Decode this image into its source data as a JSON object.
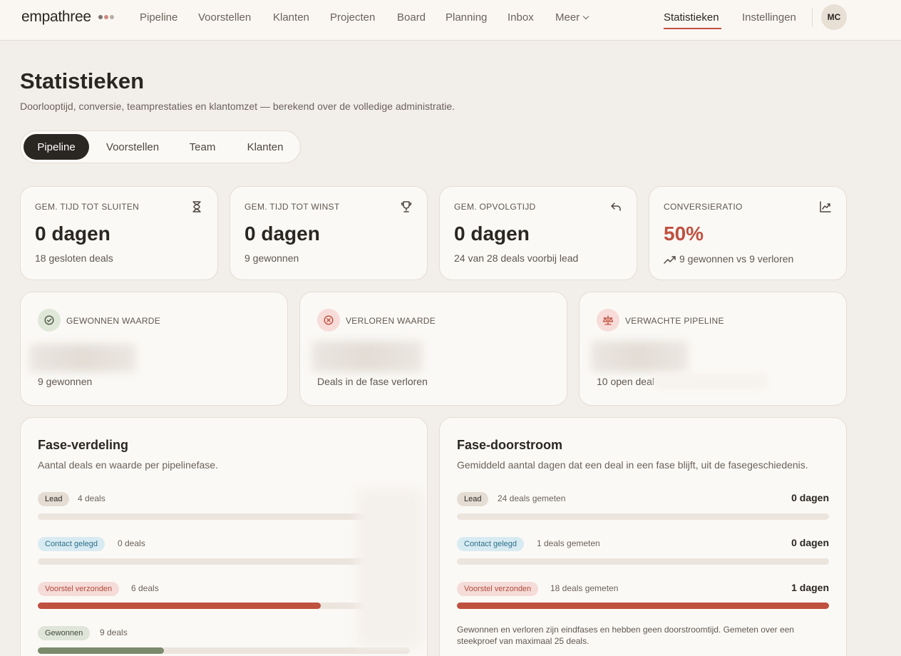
{
  "brand": {
    "name": "empathree",
    "dots": [
      "#7c7470",
      "#d08a80",
      "#b8b0a8"
    ]
  },
  "nav": {
    "items": [
      {
        "label": "Pipeline"
      },
      {
        "label": "Voorstellen"
      },
      {
        "label": "Klanten"
      },
      {
        "label": "Projecten"
      },
      {
        "label": "Board"
      },
      {
        "label": "Planning"
      },
      {
        "label": "Inbox"
      },
      {
        "label": "Meer"
      }
    ],
    "active": "Statistieken",
    "settings": "Instellingen",
    "avatar": "MC"
  },
  "page": {
    "title": "Statistieken",
    "subtitle": "Doorlooptijd, conversie, teamprestaties en klantomzet — berekend over de volledige administratie."
  },
  "tabs": [
    "Pipeline",
    "Voorstellen",
    "Team",
    "Klanten"
  ],
  "kpis": [
    {
      "label": "GEM. TIJD TOT SLUITEN",
      "value": "0 dagen",
      "foot": "18 gesloten deals",
      "icon": "hourglass-icon"
    },
    {
      "label": "GEM. TIJD TOT WINST",
      "value": "0 dagen",
      "foot": "9 gewonnen",
      "icon": "trophy-icon"
    },
    {
      "label": "GEM. OPVOLGTIJD",
      "value": "0 dagen",
      "foot": "24 van 28 deals voorbij lead",
      "icon": "reply-icon"
    },
    {
      "label": "CONVERSIERATIO",
      "value": "50%",
      "foot": "9 gewonnen vs 9 verloren",
      "icon": "chart-icon"
    }
  ],
  "values": [
    {
      "label": "GEWONNEN WAARDE",
      "foot": "9 gewonnen",
      "icon": "check-circle-icon",
      "badge_bg": "#dfe7d9",
      "icon_color": "#4a5940"
    },
    {
      "label": "VERLOREN WAARDE",
      "foot": "Deals in de fase verloren",
      "icon": "x-circle-icon",
      "badge_bg": "#f7dcd9",
      "icon_color": "#c0503f"
    },
    {
      "label": "VERWACHTE PIPELINE",
      "foot": "10 open deal",
      "icon": "scale-icon",
      "badge_bg": "#f7dcd9",
      "icon_color": "#c0503f"
    }
  ],
  "fase_verdeling": {
    "title": "Fase-verdeling",
    "subtitle": "Aantal deals en waarde per pipelinefase.",
    "rows": [
      {
        "stage": "Lead",
        "meta": "4 deals",
        "fraction": 0.0
      },
      {
        "stage": "Contact gelegd",
        "meta": "0 deals",
        "fraction": 0.0
      },
      {
        "stage": "Voorstel verzonden",
        "meta": "6 deals",
        "fraction": 0.76
      },
      {
        "stage": "Gewonnen",
        "meta": "9 deals",
        "fraction": 0.34
      }
    ]
  },
  "fase_doorstroom": {
    "title": "Fase-doorstroom",
    "subtitle": "Gemiddeld aantal dagen dat een deal in een fase blijft, uit de fasegeschiedenis.",
    "rows": [
      {
        "stage": "Lead",
        "meta": "24 deals gemeten",
        "value": "0 dagen",
        "fraction": 0.0
      },
      {
        "stage": "Contact gelegd",
        "meta": "1 deals gemeten",
        "value": "0 dagen",
        "fraction": 0.0
      },
      {
        "stage": "Voorstel verzonden",
        "meta": "18 deals gemeten",
        "value": "1 dagen",
        "fraction": 1.0
      }
    ],
    "note": "Gewonnen en verloren zijn eindfases en hebben geen doorstroomtijd. Gemeten over een steekproef van maximaal 25 deals."
  },
  "colors": {
    "accent": "#c0503f",
    "won": "#7b8a6c",
    "bar_track": "#ece5de"
  }
}
